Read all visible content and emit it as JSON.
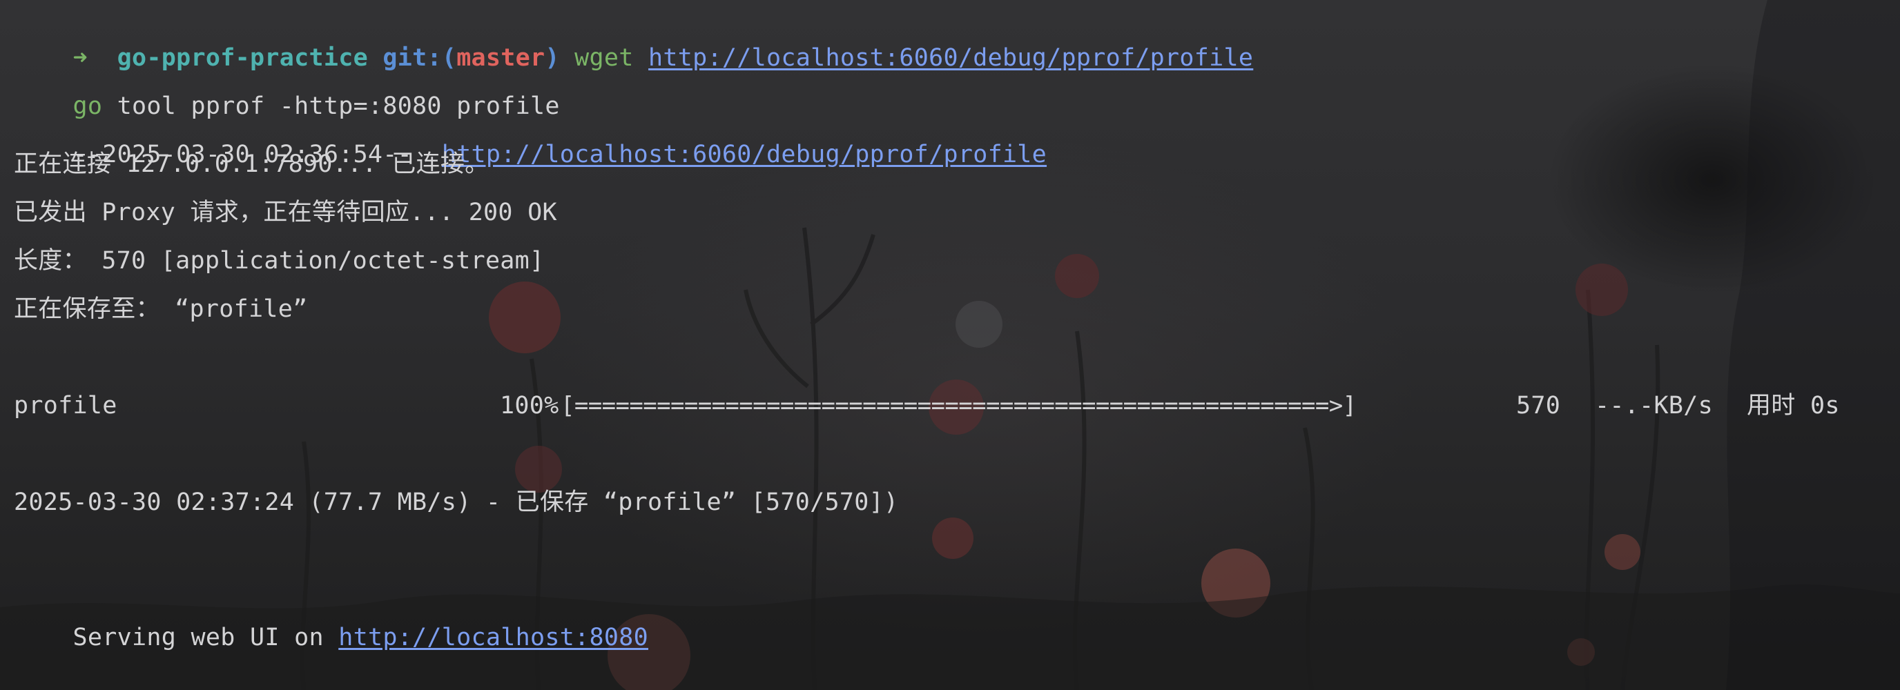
{
  "terminal": {
    "prompt": {
      "arrow": "➜",
      "directory": "go-pprof-practice",
      "git_prefix": "git:(",
      "branch": "master",
      "git_suffix": ")",
      "command": "wget",
      "url": "http://localhost:6060/debug/pprof/profile"
    },
    "line2": {
      "go_word": "go",
      "rest": "tool pprof -http=:8080 profile"
    },
    "line3": {
      "timestamp": "--2025-03-30 02:36:54--",
      "url": "http://localhost:6060/debug/pprof/profile"
    },
    "line4": "正在连接 127.0.0.1:7890... 已连接。",
    "line5": "已发出 Proxy 请求，正在等待回应... 200 OK",
    "line6": "长度： 570 [application/octet-stream]",
    "line7": "正在保存至： “profile”",
    "progress": {
      "filename": "profile",
      "percent_text": "100%",
      "bar": "[=======================================================>]",
      "size": "570",
      "speed": "--.-KB/s",
      "time": "用时 0s"
    },
    "saved_line": "2025-03-30 02:37:24 (77.7 MB/s) - 已保存 “profile” [570/570])",
    "serving": {
      "text": "Serving web UI on",
      "url": "http://localhost:8080"
    }
  },
  "colors": {
    "background": "#2a2a2c",
    "text": "#d4d4d6",
    "prompt_arrow": "#7bb566",
    "prompt_dir": "#4fb3b0",
    "git_word": "#5b8fd6",
    "git_branch": "#e0645e",
    "command_green": "#7bb566",
    "link": "#7c9ef0"
  }
}
